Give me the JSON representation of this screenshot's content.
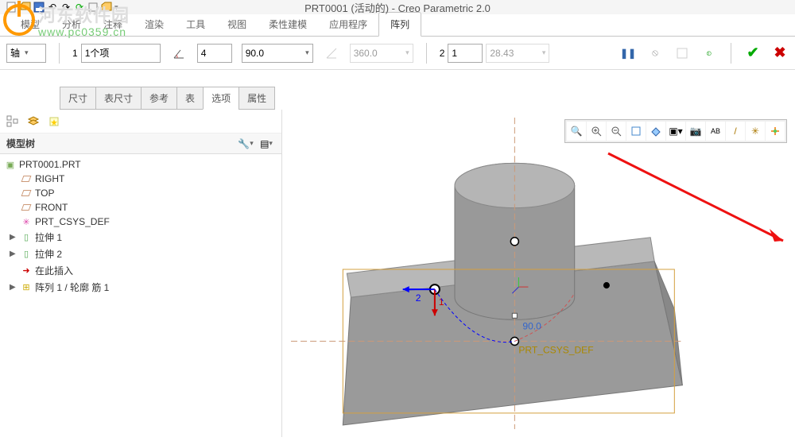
{
  "title": "PRT0001 (活动的) - Creo Parametric 2.0",
  "ribbon": {
    "tabs": [
      "模型",
      "分析",
      "注释",
      "渲染",
      "工具",
      "视图",
      "柔性建模",
      "应用程序",
      "阵列"
    ],
    "active": 8
  },
  "options": {
    "type_label": "轴",
    "count_prefix": "1",
    "count_label": "1个项",
    "angle1_count": "4",
    "angle1_value": "90.0",
    "angle2_value": "360.0",
    "ext2_count": "1",
    "ext2_value": "28.43",
    "dim2_prefix": "2"
  },
  "subtabs": {
    "items": [
      "尺寸",
      "表尺寸",
      "参考",
      "表",
      "选项",
      "属性"
    ],
    "active": 4
  },
  "sidebar": {
    "title": "模型树",
    "root": "PRT0001.PRT",
    "planes": [
      "RIGHT",
      "TOP",
      "FRONT"
    ],
    "csys": "PRT_CSYS_DEF",
    "features": [
      {
        "name": "拉伸 1",
        "type": "extrude"
      },
      {
        "name": "拉伸 2",
        "type": "extrude"
      }
    ],
    "insert": "在此插入",
    "pattern": "阵列 1 / 轮廓 筋 1"
  },
  "viewport": {
    "csys_label": "PRT_CSYS_DEF",
    "dim_label_1": "1",
    "dim_label_2": "2",
    "dim_value": "90.0"
  },
  "watermark": {
    "text": "河东软件园",
    "url": "www.pc0359.cn"
  }
}
